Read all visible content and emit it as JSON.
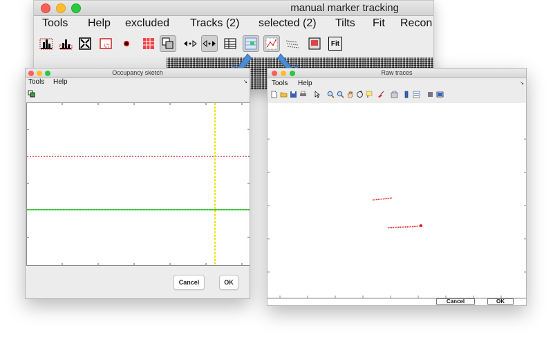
{
  "main_window": {
    "title": "manual marker tracking",
    "menu": [
      "Tools",
      "Help",
      "excluded",
      "Tracks (2)",
      "selected (2)",
      "Tilts",
      "Fit",
      "Recon"
    ],
    "toolbar_icons": [
      "histogram-icon",
      "histogram-fill-icon",
      "expand-icon",
      "box-icon",
      "dot-icon",
      "grid-icon",
      "overlap-icon",
      "arrows-left-icon",
      "arrows-right-icon",
      "table-icon",
      "select-icon",
      "scatter-icon",
      "text-lines-icon",
      "frame-icon",
      "fit-icon"
    ],
    "toolbar_fit_label": "Fit"
  },
  "occupancy_window": {
    "title": "Occupancy sketch",
    "menu": [
      "Tools",
      "Help"
    ],
    "corner_glyph": "↘",
    "cancel_label": "Cancel",
    "ok_label": "OK",
    "line_colors": {
      "dotted_horizontal": "#e23b3b",
      "solid_horizontal": "#00d400",
      "dotted_horizontal_overlay": "#1a7a1a",
      "dotted_vertical": "#f2e200"
    }
  },
  "raw_window": {
    "title": "Raw traces",
    "menu": [
      "Tools",
      "Help"
    ],
    "corner_glyph": "↘",
    "toolbar_icons": [
      "new-file-icon",
      "open-file-icon",
      "save-icon",
      "print-icon",
      "pointer-icon",
      "zoom-in-icon",
      "zoom-out-icon",
      "pan-icon",
      "rotate-icon",
      "data-cursor-icon",
      "brush-icon",
      "link-icon",
      "colorbar-icon",
      "legend-icon",
      "hide-plot-tools-icon",
      "show-plot-tools-icon"
    ],
    "cancel_label": "Cancel",
    "ok_label": "OK",
    "trace_color": "#e02020"
  },
  "window_controls": {
    "close_color": "#fc5f57",
    "minimize_color": "#fdbc2e",
    "zoom_color": "#28c840"
  }
}
